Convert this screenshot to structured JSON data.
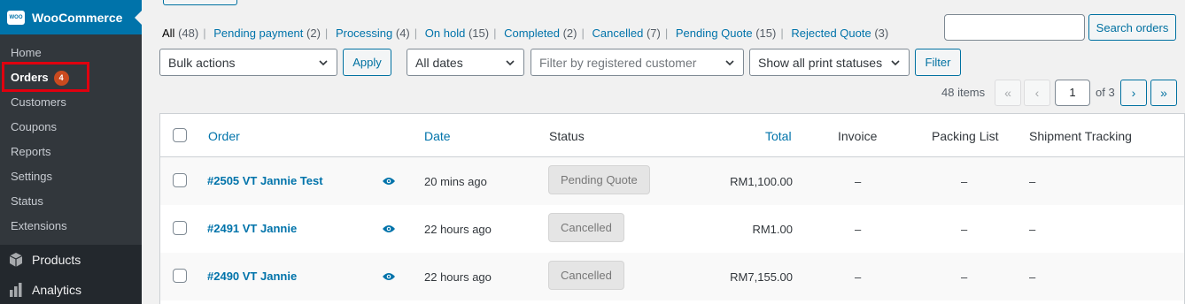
{
  "sidebar": {
    "woo_logo": "WOO",
    "title": "WooCommerce",
    "submenu": [
      "Home",
      "Orders",
      "Customers",
      "Coupons",
      "Reports",
      "Settings",
      "Status",
      "Extensions"
    ],
    "orders_badge": "4",
    "main": [
      {
        "label": "Products",
        "icon": "products-cube-icon"
      },
      {
        "label": "Analytics",
        "icon": "analytics-bar-icon"
      }
    ]
  },
  "filters": {
    "links": [
      {
        "label": "All",
        "count": "(48)"
      },
      {
        "label": "Pending payment",
        "count": "(2)"
      },
      {
        "label": "Processing",
        "count": "(4)"
      },
      {
        "label": "On hold",
        "count": "(15)"
      },
      {
        "label": "Completed",
        "count": "(2)"
      },
      {
        "label": "Cancelled",
        "count": "(7)"
      },
      {
        "label": "Pending Quote",
        "count": "(15)"
      },
      {
        "label": "Rejected Quote",
        "count": "(3)"
      }
    ]
  },
  "search": {
    "placeholder": "",
    "button": "Search orders"
  },
  "toolbar": {
    "bulk_actions": "Bulk actions",
    "apply": "Apply",
    "dates": "All dates",
    "customer_placeholder": "Filter by registered customer",
    "print_status": "Show all print statuses",
    "filter": "Filter"
  },
  "pagination": {
    "items": "48 items",
    "first": "«",
    "prev": "‹",
    "current": "1",
    "of": "of 3",
    "next": "›",
    "last": "»"
  },
  "table": {
    "headers": {
      "order": "Order",
      "date": "Date",
      "status": "Status",
      "total": "Total",
      "invoice": "Invoice",
      "packing": "Packing List",
      "tracking": "Shipment Tracking"
    },
    "rows": [
      {
        "order": "#2505 VT Jannie Test",
        "date": "20 mins ago",
        "status": "Pending Quote",
        "total": "RM1,100.00",
        "invoice": "–",
        "packing": "–",
        "tracking": "–"
      },
      {
        "order": "#2491 VT Jannie",
        "date": "22 hours ago",
        "status": "Cancelled",
        "total": "RM1.00",
        "invoice": "–",
        "packing": "–",
        "tracking": "–"
      },
      {
        "order": "#2490 VT Jannie",
        "date": "22 hours ago",
        "status": "Cancelled",
        "total": "RM7,155.00",
        "invoice": "–",
        "packing": "–",
        "tracking": "–"
      }
    ]
  }
}
